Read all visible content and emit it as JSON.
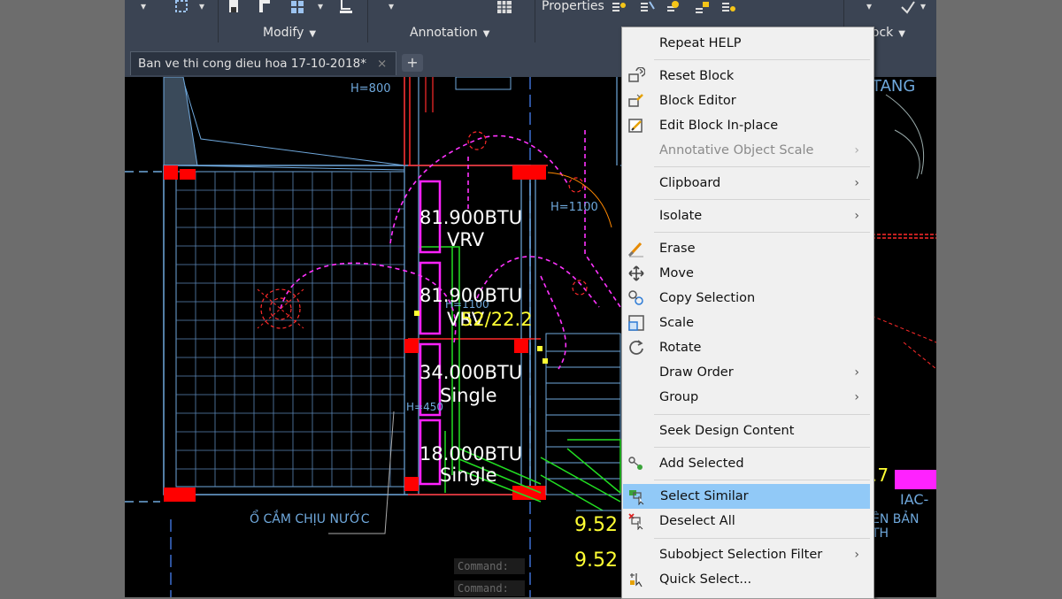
{
  "ribbon": {
    "panels": [
      {
        "label": "Modify"
      },
      {
        "label": "Annotation"
      },
      {
        "label": "Properties"
      },
      {
        "label": "lock"
      }
    ]
  },
  "file_tab": {
    "label": "Ban ve thi cong dieu hoa 17-10-2018*",
    "close": "×",
    "new_tab": "+"
  },
  "drawing": {
    "labels": {
      "h800": "H=800",
      "h1100a": "H=1100",
      "h1100b": "H=1100",
      "h450": "H=450",
      "unit1_cap": "81.900BTU",
      "unit1_type": "VRV",
      "unit2_cap": "81.900BTU",
      "unit2_type": "VRV",
      "pipe_size": "52/22.2",
      "unit3_cap": "34.000BTU",
      "unit3_type": "Single",
      "unit4_cap": "18.000BTU",
      "unit4_type": "Single",
      "socket": "Ổ CẮM CHỊU NƯỚC",
      "tang": "TANG",
      "num1": "9.52",
      "num2": "9.52",
      "iac": "IAC-",
      "seven": ".7",
      "ban": "ÊN BẢN TH"
    },
    "command_lines": [
      "Command:",
      "Command:"
    ]
  },
  "context_menu": {
    "items": [
      {
        "label": "Repeat HELP",
        "icon": "none"
      },
      {
        "label": "Reset Block",
        "icon": "reset-block-icon"
      },
      {
        "label": "Block Editor",
        "icon": "block-editor-icon"
      },
      {
        "label": "Edit Block In-place",
        "icon": "edit-block-icon"
      },
      {
        "label": "Annotative Object Scale",
        "icon": "none",
        "disabled": true,
        "submenu": true
      },
      {
        "label": "Clipboard",
        "icon": "none",
        "submenu": true
      },
      {
        "label": "Isolate",
        "icon": "none",
        "submenu": true
      },
      {
        "label": "Erase",
        "icon": "erase-icon"
      },
      {
        "label": "Move",
        "icon": "move-icon"
      },
      {
        "label": "Copy Selection",
        "icon": "copy-icon"
      },
      {
        "label": "Scale",
        "icon": "scale-icon"
      },
      {
        "label": "Rotate",
        "icon": "rotate-icon"
      },
      {
        "label": "Draw Order",
        "icon": "none",
        "submenu": true
      },
      {
        "label": "Group",
        "icon": "none",
        "submenu": true
      },
      {
        "label": "Seek Design Content",
        "icon": "none"
      },
      {
        "label": "Add Selected",
        "icon": "add-selected-icon"
      },
      {
        "label": "Select Similar",
        "icon": "select-similar-icon",
        "highlighted": true
      },
      {
        "label": "Deselect All",
        "icon": "deselect-icon"
      },
      {
        "label": "Subobject Selection Filter",
        "icon": "none",
        "submenu": true
      },
      {
        "label": "Quick Select...",
        "icon": "quick-select-icon"
      }
    ],
    "submenu_arrow": "›"
  },
  "colors": {
    "ribbon_bg": "#3b4453",
    "menu_bg": "#f0f0f0",
    "menu_highlight": "#91c9f7",
    "cad_blue": "#6fa8dc",
    "cad_red": "#ff2a2a",
    "cad_magenta": "#ff22ff",
    "cad_green": "#22dd22",
    "cad_yellow": "#ffff33"
  }
}
